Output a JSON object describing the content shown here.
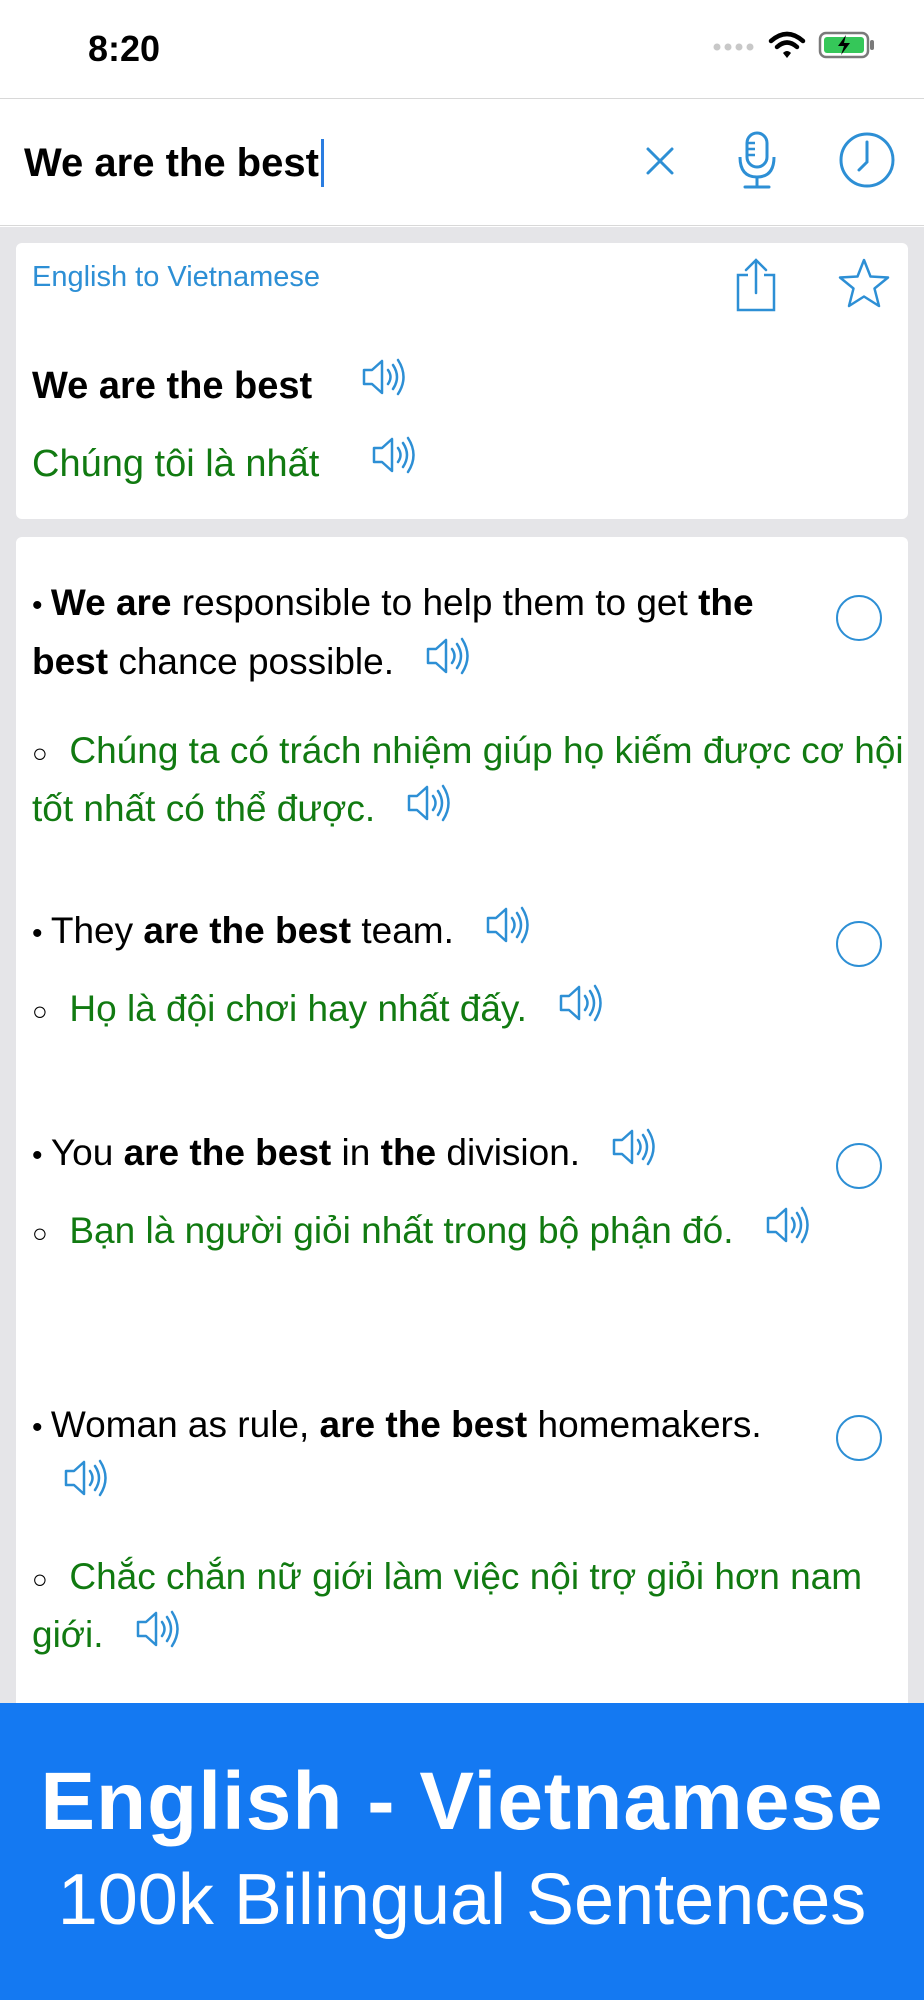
{
  "status_bar": {
    "time": "8:20"
  },
  "search": {
    "query": "We are the best"
  },
  "result_card": {
    "direction_label": "English to Vietnamese",
    "source": "We are the best",
    "translation": "Chúng tôi là nhất"
  },
  "examples": [
    {
      "source_parts": [
        {
          "t": "We are",
          "b": true
        },
        {
          "t": " responsible to help them to get ",
          "b": false
        },
        {
          "t": "the best",
          "b": true
        },
        {
          "t": " chance possible.",
          "b": false
        }
      ],
      "translation": "Chúng ta có trách nhiệm giúp họ kiếm được cơ hội tốt nhất có thể được."
    },
    {
      "source_parts": [
        {
          "t": "They ",
          "b": false
        },
        {
          "t": "are the best",
          "b": true
        },
        {
          "t": " team.",
          "b": false
        }
      ],
      "translation": "Họ là đội chơi hay nhất đấy."
    },
    {
      "source_parts": [
        {
          "t": "You ",
          "b": false
        },
        {
          "t": "are the best",
          "b": true
        },
        {
          "t": " in ",
          "b": false
        },
        {
          "t": "the",
          "b": true
        },
        {
          "t": " division.",
          "b": false
        }
      ],
      "translation": "Bạn là người giỏi nhất trong bộ phận đó."
    },
    {
      "source_parts": [
        {
          "t": "Woman as rule, ",
          "b": false
        },
        {
          "t": "are the best",
          "b": true
        },
        {
          "t": " homemakers.",
          "b": false
        }
      ],
      "translation": "Chắc chắn nữ giới làm việc nội trợ giỏi hơn nam giới."
    }
  ],
  "banner": {
    "line1": "English - Vietnamese",
    "line2": "100k Bilingual Sentences"
  },
  "colors": {
    "accent": "#2d8fd5",
    "translation_green": "#117a11",
    "banner_blue": "#1479f2",
    "background_gray": "#e5e5e8"
  }
}
